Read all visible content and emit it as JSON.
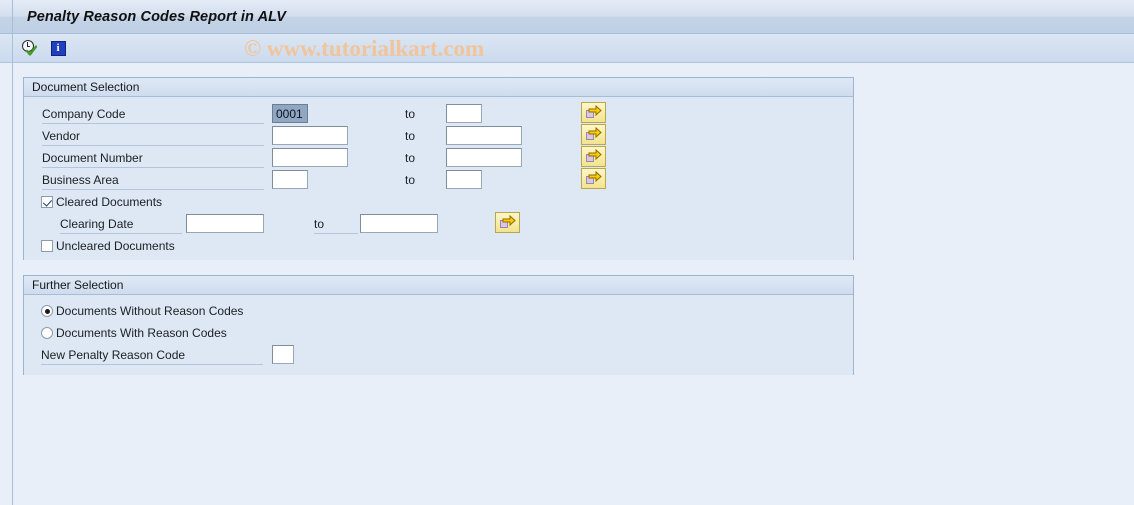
{
  "window": {
    "title": "Penalty Reason Codes Report in ALV"
  },
  "toolbar": {
    "execute_icon": "clock-check-execute-icon",
    "info_icon": "information-icon",
    "info_glyph": "i"
  },
  "watermark": {
    "text": "© www.tutorialkart.com"
  },
  "document_selection": {
    "title": "Document Selection",
    "to_label": "to",
    "rows": [
      {
        "label": "Company Code",
        "from_value": "0001",
        "from_selected": true,
        "to_value": ""
      },
      {
        "label": "Vendor",
        "from_value": "",
        "from_selected": false,
        "to_value": ""
      },
      {
        "label": "Document Number",
        "from_value": "",
        "from_selected": false,
        "to_value": ""
      },
      {
        "label": "Business Area",
        "from_value": "",
        "from_selected": false,
        "to_value": ""
      }
    ],
    "cleared_documents": {
      "label": "Cleared Documents",
      "checked": true
    },
    "clearing_date": {
      "label": "Clearing Date",
      "from_value": "",
      "to_label": "to",
      "to_value": ""
    },
    "uncleared_documents": {
      "label": "Uncleared Documents",
      "checked": false
    },
    "multi_select_icon": "multiple-selection-arrow-icon"
  },
  "further_selection": {
    "title": "Further Selection",
    "options": [
      {
        "label": "Documents Without Reason Codes",
        "selected": true
      },
      {
        "label": "Documents With Reason Codes",
        "selected": false
      }
    ],
    "new_penalty_reason_code": {
      "label": "New Penalty Reason Code",
      "value": ""
    }
  },
  "colors": {
    "window_bg": "#e9eff8",
    "panel_bg": "#dde8f4",
    "panel_border": "#9db4d0",
    "title_bar": "#c5d4e7",
    "selection_blue": "#8fa7c3",
    "button_yellow": "#f7eda7",
    "watermark": "#f1c49a"
  }
}
